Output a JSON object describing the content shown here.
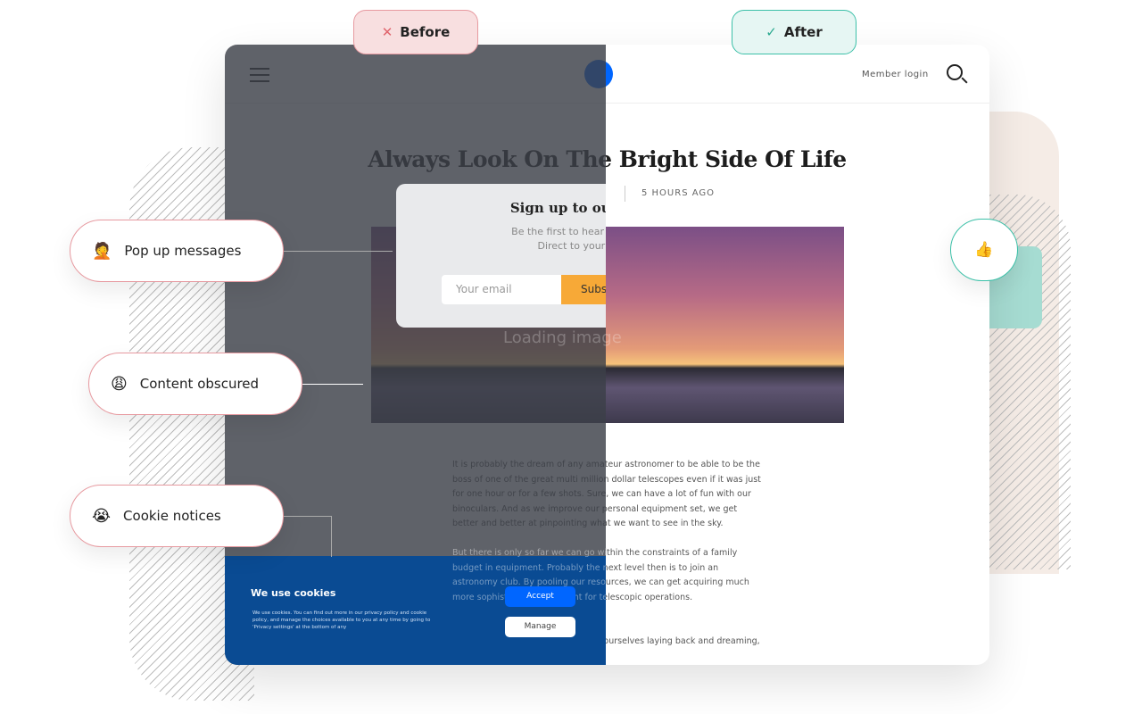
{
  "badges": {
    "before": "Before",
    "after": "After"
  },
  "labels": [
    {
      "emoji": "🤦",
      "text": "Pop up messages"
    },
    {
      "emoji": "😩",
      "text": "Content obscured"
    },
    {
      "emoji": "😭",
      "text": "Cookie notices"
    }
  ],
  "thumbs": "👍",
  "header": {
    "member_login": "Member login"
  },
  "article": {
    "title": "Always Look On The Bright Side Of Life",
    "time": "5 HOURS AGO",
    "para1": "It is probably the dream of any amateur astronomer to be able to be the boss of one of the great multi million dollar telescopes even if it was just for one hour or for a few shots. Sure, we can have a lot of fun with our binoculars. And as we improve our personal equipment set, we get better and better at pinpointing what we want to see in the sky.",
    "para2": "But there is only so far we can go within the constraints of a family budget in equipment. Probably the next level then is to join an astronomy club. By pooling our resources, we can get acquiring much more sophisticated equipment for telescopic operations.",
    "para3": "... it and play with it always finding ourselves laying back and dreaming, it’s those big"
  },
  "popup": {
    "title": "Sign up to our newsletter",
    "line1": "Be the first to hear all the latest news.",
    "line2": "Direct to your inbox weekly.",
    "placeholder": "Your email",
    "button": "Subscribe",
    "loading": "Loading image"
  },
  "cookie": {
    "title": "We use cookies",
    "body": "We use cookies. You can find out more in our privacy policy and cookie policy, and manage the choices available to you at any time by going to 'Privacy settings' at the bottom of any",
    "accept": "Accept",
    "manage": "Manage"
  },
  "colors": {
    "accent": "#0066ff",
    "cookie_bg": "#0a4b93",
    "subscribe": "#f7a937",
    "before": "#f8dfe0",
    "after": "#e6f6f3"
  }
}
